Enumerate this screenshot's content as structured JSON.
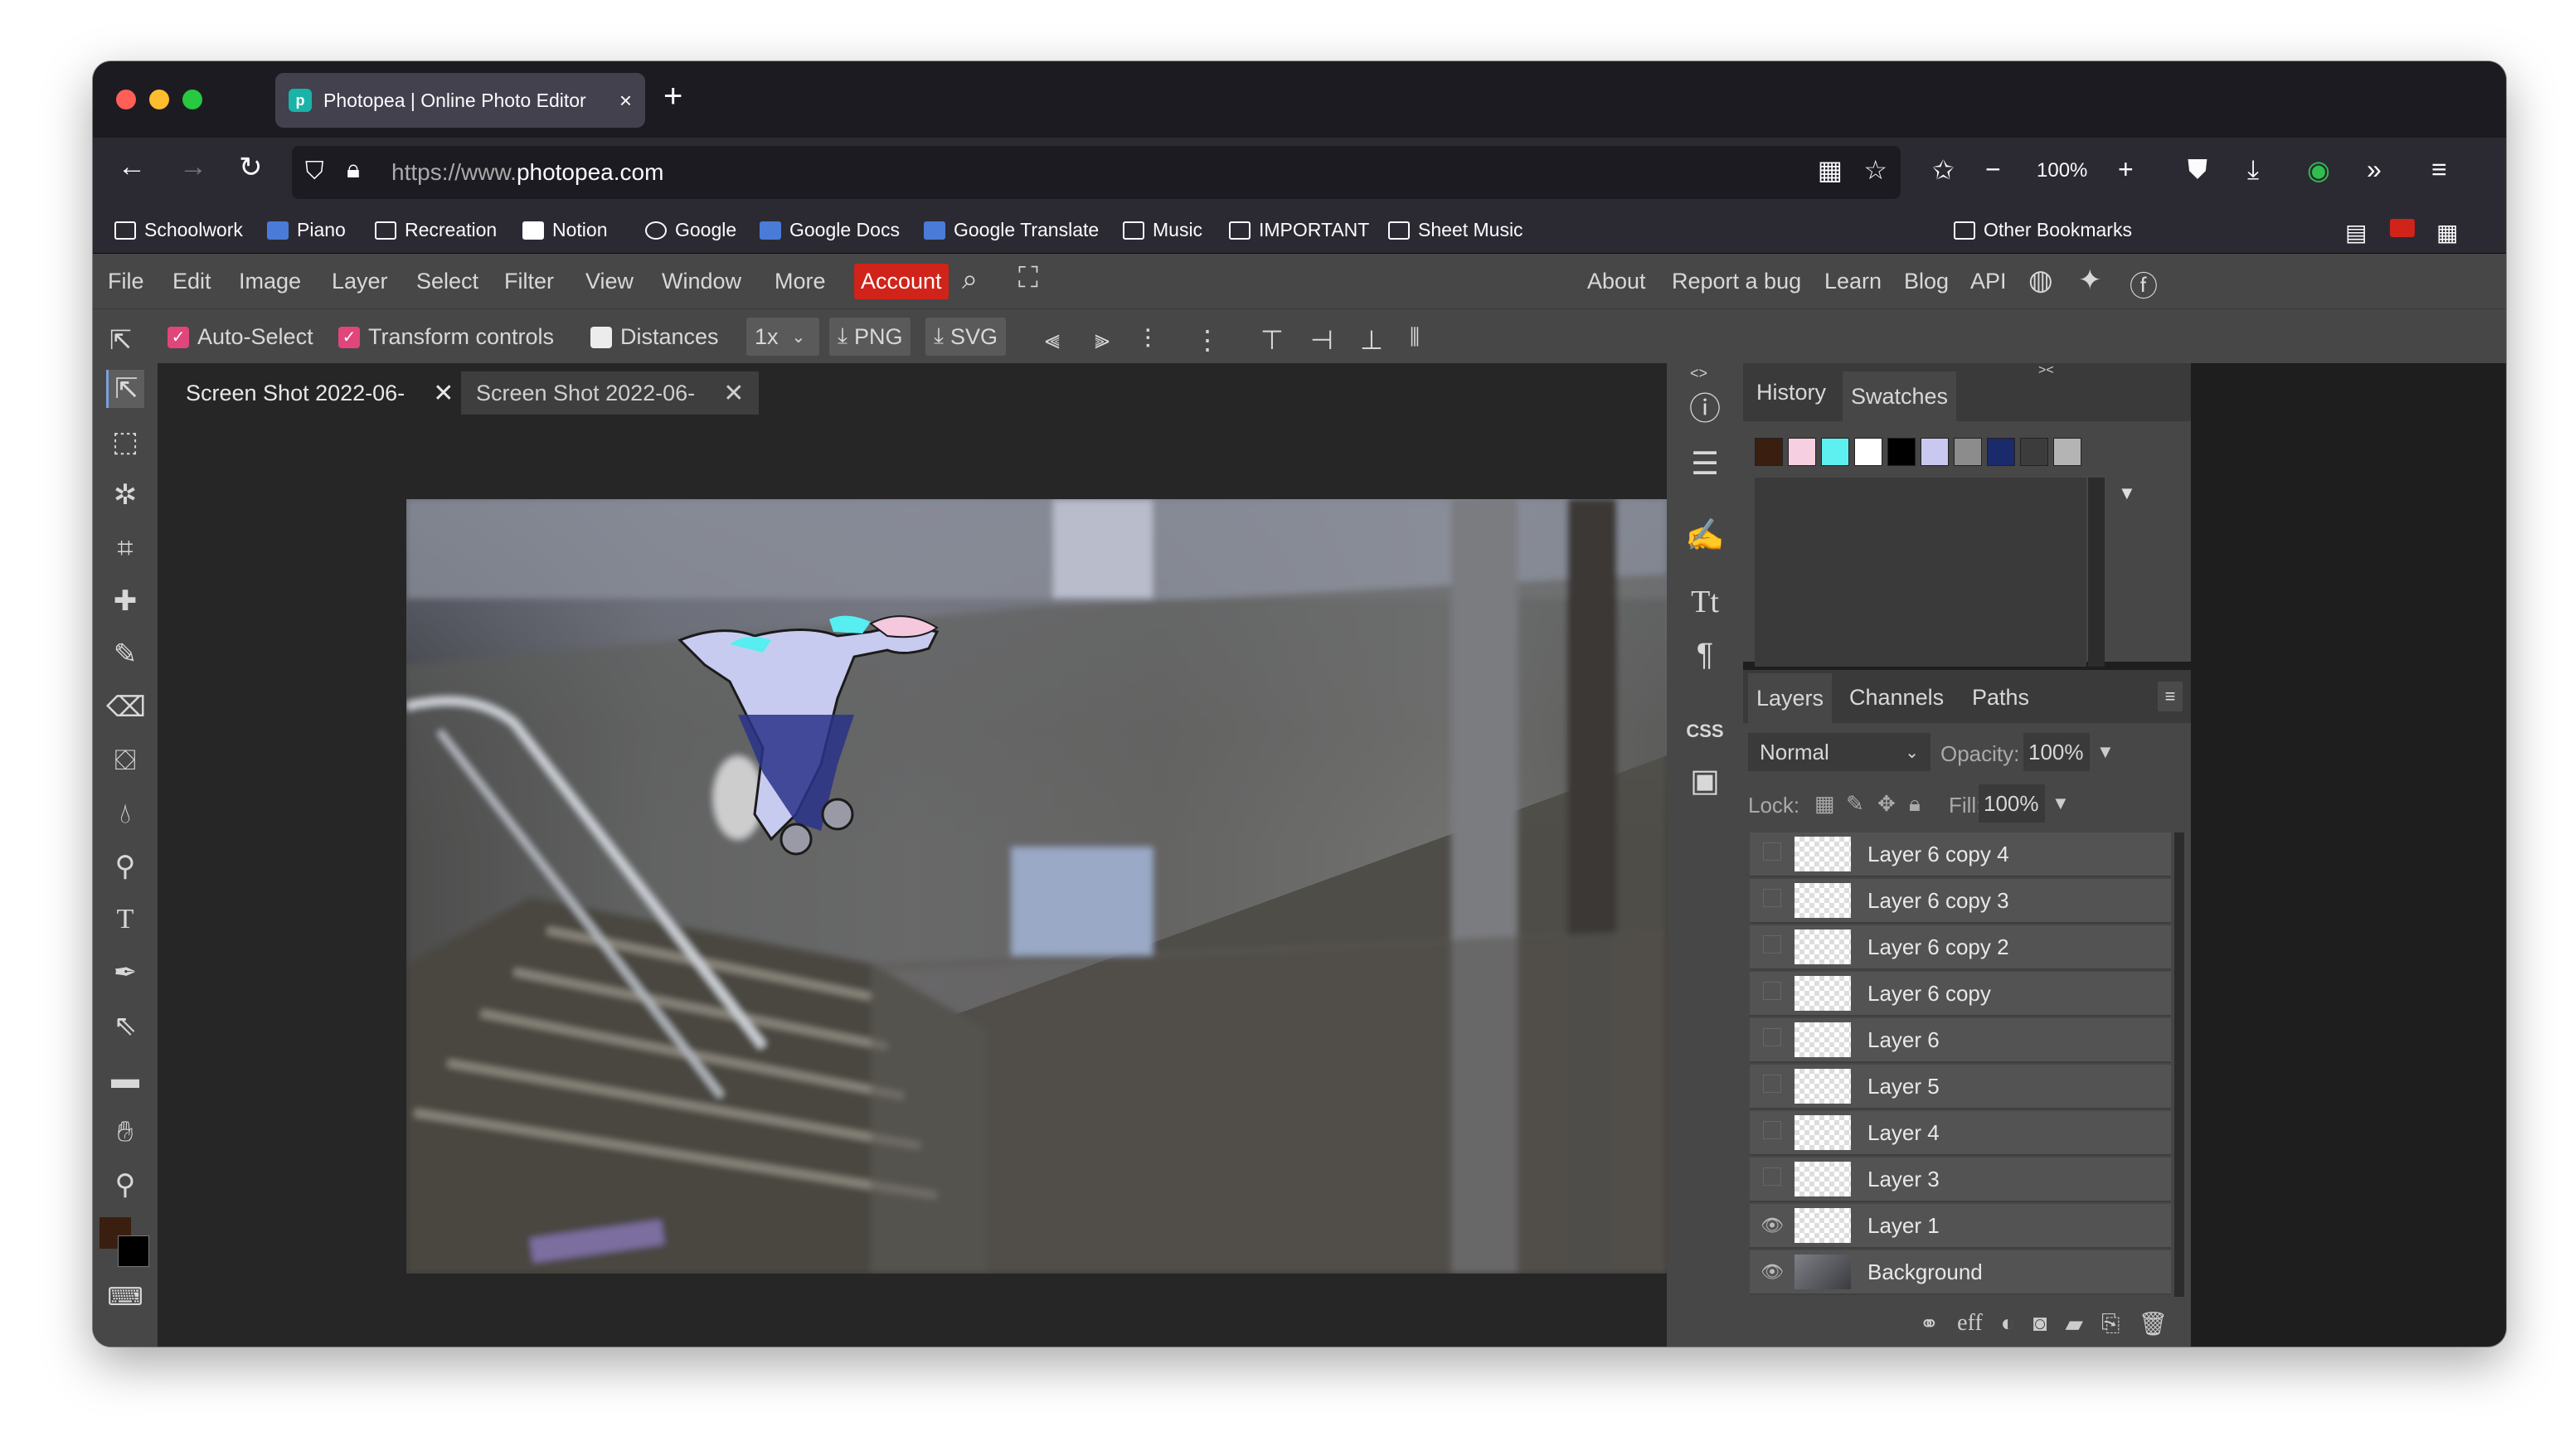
{
  "browser": {
    "tab_title": "Photopea | Online Photo Editor",
    "tab_close": "×",
    "new_tab": "+",
    "url_prefix": "https://www.",
    "url_domain": "photopea.com",
    "zoom": "100%",
    "bookmarks": [
      "Schoolwork",
      "Piano",
      "Recreation",
      "Notion",
      "Google",
      "Google Docs",
      "Google Translate",
      "Music",
      "IMPORTANT",
      "Sheet Music"
    ],
    "other_bookmarks": "Other Bookmarks"
  },
  "photopea": {
    "menus": [
      "File",
      "Edit",
      "Image",
      "Layer",
      "Select",
      "Filter",
      "View",
      "Window",
      "More"
    ],
    "account": "Account",
    "right_links": [
      "About",
      "Report a bug",
      "Learn",
      "Blog",
      "API"
    ],
    "options": {
      "auto_select": "Auto-Select",
      "transform_controls": "Transform controls",
      "distances": "Distances",
      "scale": "1x",
      "png": "PNG",
      "svg": "SVG"
    },
    "doc_tabs": [
      "Screen Shot 2022-06-",
      "Screen Shot 2022-06-"
    ],
    "history_tab": "History",
    "swatches_tab": "Swatches",
    "swatch_colors": [
      "#3a1f10",
      "#f6cfe0",
      "#5ef0f0",
      "#ffffff",
      "#000000",
      "#c8c8f0",
      "#8c8c8c",
      "#1a2a6a",
      "#3c3c3c",
      "#b4b4b4"
    ],
    "layers_tabs": [
      "Layers",
      "Channels",
      "Paths"
    ],
    "blend_mode": "Normal",
    "opacity_label": "Opacity:",
    "opacity_value": "100%",
    "lock_label": "Lock:",
    "fill_label": "Fill:",
    "fill_value": "100%",
    "layers": [
      {
        "name": "Layer 6 copy 4",
        "visible": false
      },
      {
        "name": "Layer 6 copy 3",
        "visible": false
      },
      {
        "name": "Layer 6 copy 2",
        "visible": false
      },
      {
        "name": "Layer 6 copy",
        "visible": false
      },
      {
        "name": "Layer 6",
        "visible": false
      },
      {
        "name": "Layer 5",
        "visible": false
      },
      {
        "name": "Layer 4",
        "visible": false
      },
      {
        "name": "Layer 3",
        "visible": false
      },
      {
        "name": "Layer 1",
        "visible": true
      },
      {
        "name": "Background",
        "visible": true
      }
    ],
    "foreground_color": "#3a1f10",
    "background_color": "#000000"
  }
}
